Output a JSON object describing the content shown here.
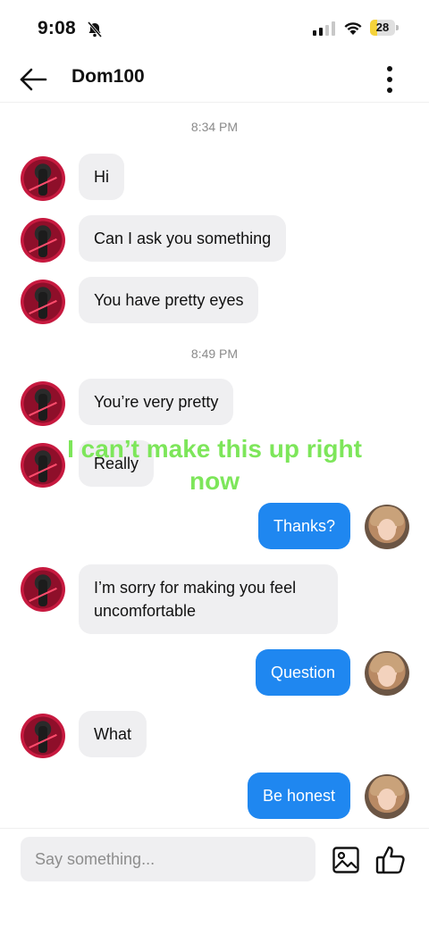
{
  "status_bar": {
    "time": "9:08",
    "battery": "28",
    "battery_level": 0.28,
    "icons": [
      "bell-slash-icon",
      "signal-icon",
      "wifi-icon",
      "battery-icon"
    ]
  },
  "header": {
    "contact_name": "Dom100",
    "back_icon": "arrow-left-icon",
    "more_icon": "more-vertical-icon"
  },
  "chat": {
    "timestamps": [
      "8:34 PM",
      "8:49 PM"
    ],
    "messages": [
      {
        "from": "them",
        "text": "Hi"
      },
      {
        "from": "them",
        "text": "Can I ask you something"
      },
      {
        "from": "them",
        "text": "You have pretty eyes"
      },
      {
        "from": "them",
        "text": "You’re very pretty"
      },
      {
        "from": "them",
        "text": "Really"
      },
      {
        "from": "me",
        "text": "Thanks?"
      },
      {
        "from": "them",
        "text": "I’m sorry for making you feel uncomfortable"
      },
      {
        "from": "me",
        "text": "Question"
      },
      {
        "from": "them",
        "text": "What"
      },
      {
        "from": "me",
        "text": "Be honest"
      }
    ]
  },
  "overlay_caption": "I can’t make this up right now",
  "composer": {
    "placeholder": "Say something...",
    "image_icon": "image-icon",
    "like_icon": "thumbs-up-icon"
  },
  "colors": {
    "outgoing_bubble": "#1f87f0",
    "incoming_bubble": "#efeff1",
    "overlay_text": "#7de65a",
    "battery": "#f5d33b"
  }
}
